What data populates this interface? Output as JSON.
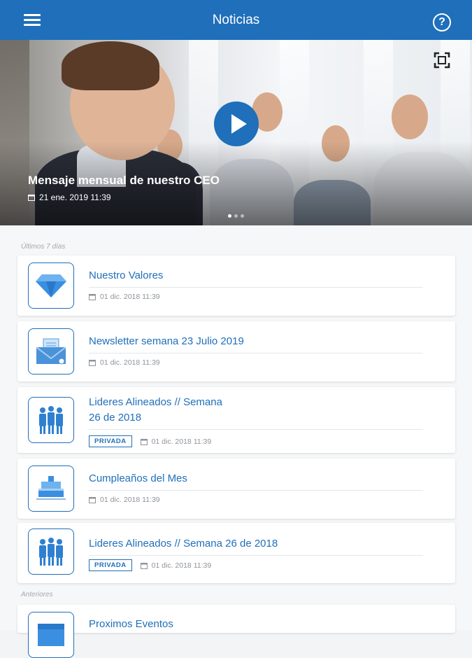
{
  "header": {
    "title": "Noticias",
    "menu_icon": "hamburger-menu-icon",
    "help_icon": "help-circle-icon",
    "help_glyph": "?"
  },
  "hero": {
    "title": "Mensaje mensual de nuestro CEO",
    "date": "21 ene. 2019  11:39",
    "slide_count": 3,
    "active_slide": 1,
    "accent": "#1f6fba"
  },
  "sections": {
    "recent_label": "Últimos 7 días",
    "older_label": "Anteriores"
  },
  "news": [
    {
      "title": "Nuestro Valores",
      "date": "01 dic. 2018  11:39",
      "badge": "",
      "icon": "diamond-icon"
    },
    {
      "title": "Newsletter semana 23 Julio 2019",
      "date": "01 dic. 2018  11:39",
      "badge": "",
      "icon": "newsletter-envelope-icon"
    },
    {
      "title": "Lideres Alineados // Semana 26 de 2018",
      "title_line1": "Lideres Alineados // Semana",
      "title_line2": "26 de 2018",
      "date": "01 dic. 2018  11:39",
      "badge": "PRIVADA",
      "icon": "team-people-icon"
    },
    {
      "title": "Cumpleaños del Mes",
      "date": "01 dic. 2018  11:39",
      "badge": "",
      "icon": "birthday-cake-icon"
    },
    {
      "title": "Lideres Alineados // Semana 26 de 2018",
      "date": "01 dic. 2018  11:39",
      "badge": "PRIVADA",
      "icon": "team-people-icon"
    },
    {
      "title": "Proximos Eventos",
      "date": "",
      "badge": "",
      "icon": "calendar-events-icon"
    }
  ]
}
